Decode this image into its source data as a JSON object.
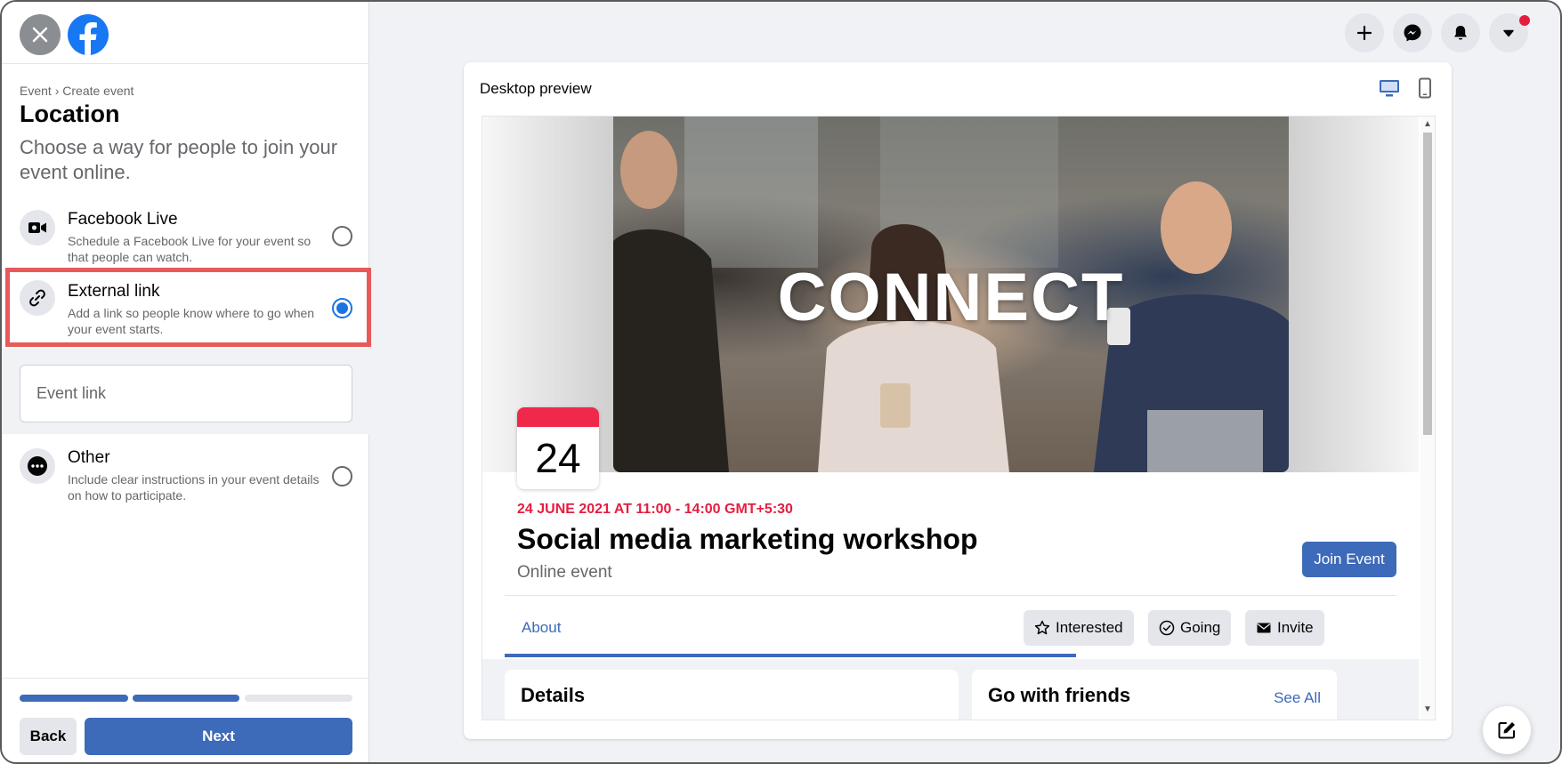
{
  "left_panel": {
    "breadcrumb": [
      "Event",
      "Create event"
    ],
    "breadcrumb_separator": "›",
    "title": "Location",
    "subtitle": "Choose a way for people to join your event online.",
    "options": [
      {
        "title": "Facebook Live",
        "description": "Schedule a Facebook Live for your event so that people can watch.",
        "icon": "video-camera-icon",
        "selected": false
      },
      {
        "title": "External link",
        "description": "Add a link so people know where to go when your event starts.",
        "icon": "link-icon",
        "selected": true
      },
      {
        "title": "Other",
        "description": "Include clear instructions in your event details on how to participate.",
        "icon": "more-icon",
        "selected": false
      }
    ],
    "event_link": {
      "placeholder": "Event link",
      "value": ""
    },
    "progress": {
      "steps_total": 3,
      "steps_completed": 2
    },
    "back_label": "Back",
    "next_label": "Next"
  },
  "nav": {
    "icons": [
      "plus-icon",
      "messenger-icon",
      "bell-icon",
      "caret-down-icon"
    ],
    "notification_dot": true
  },
  "preview": {
    "label": "Desktop preview",
    "modes": [
      "desktop-icon",
      "mobile-icon"
    ],
    "active_mode": "desktop",
    "cover_text": "CONNECT",
    "date_badge_day": "24",
    "event_datetime": "24 JUNE 2021 AT 11:00 - 14:00 GMT+5:30",
    "event_title": "Social media marketing workshop",
    "event_type": "Online event",
    "join_label": "Join Event",
    "tab_about": "About",
    "actions": [
      {
        "label": "Interested",
        "icon": "star-icon"
      },
      {
        "label": "Going",
        "icon": "check-circle-icon"
      },
      {
        "label": "Invite",
        "icon": "envelope-icon"
      }
    ],
    "details_title": "Details",
    "friends_title": "Go with friends",
    "see_all_label": "See All"
  },
  "colors": {
    "accent": "#3d6ab9",
    "facebook_blue": "#1877f2",
    "date_red": "#e41e3f",
    "highlight": "#e85a5a"
  }
}
